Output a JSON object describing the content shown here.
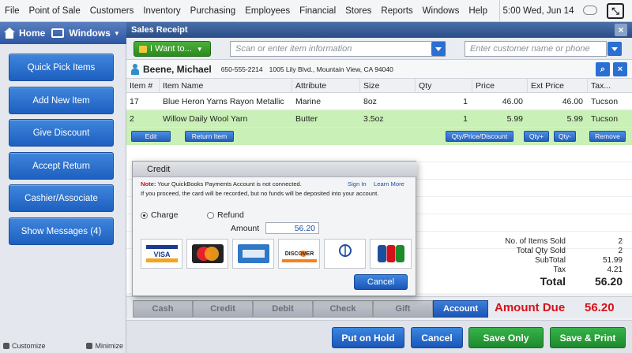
{
  "menubar": {
    "items": [
      "File",
      "Point of Sale",
      "Customers",
      "Inventory",
      "Purchasing",
      "Employees",
      "Financial",
      "Stores",
      "Reports",
      "Windows",
      "Help"
    ],
    "clock": "5:00 Wed, Jun 14"
  },
  "sidebar": {
    "home": "Home",
    "windows": "Windows",
    "buttons": [
      "Quick Pick Items",
      "Add New Item",
      "Give Discount",
      "Accept Return",
      "Cashier/Associate",
      "Show Messages (4)"
    ],
    "customize": "Customize",
    "minimize": "Minimize"
  },
  "window": {
    "title": "Sales Receipt",
    "close": "×"
  },
  "toolbar": {
    "iwant": "I Want to...",
    "scan_placeholder": "Scan or enter item information",
    "customer_placeholder": "Enter customer name or phone"
  },
  "customer": {
    "name": "Beene, Michael",
    "phone": "650-555-2214",
    "address": "1005 Lily Blvd., Mountain View, CA 94040"
  },
  "grid": {
    "headers": [
      "Item #",
      "Item Name",
      "Attribute",
      "Size",
      "Qty",
      "Price",
      "Ext Price",
      "Tax..."
    ],
    "rows": [
      {
        "item": "17",
        "name": "Blue Heron Yarns Rayon Metallic",
        "attribute": "Marine",
        "size": "8oz",
        "qty": "1",
        "price": "46.00",
        "ext": "46.00",
        "tax": "Tucson"
      },
      {
        "item": "2",
        "name": "Willow Daily Wool Yarn",
        "attribute": "Butter",
        "size": "3.5oz",
        "qty": "1",
        "price": "5.99",
        "ext": "5.99",
        "tax": "Tucson"
      }
    ],
    "actions": {
      "edit": "Edit",
      "return": "Return Item",
      "qtyprice": "Qty/Price/Discount",
      "qtyplus": "Qty+",
      "qtyminus": "Qty-",
      "remove": "Remove"
    }
  },
  "totals": {
    "items_sold_lbl": "No. of Items Sold",
    "items_sold": "2",
    "total_qty_lbl": "Total Qty Sold",
    "total_qty": "2",
    "subtotal_lbl": "SubTotal",
    "subtotal": "51.99",
    "tax_lbl": "Tax",
    "tax": "4.21",
    "total_lbl": "Total",
    "total": "56.20"
  },
  "payment": {
    "tabs": [
      "Cash",
      "Credit",
      "Debit",
      "Check",
      "Gift",
      "Account"
    ],
    "active": "Account",
    "amount_due_lbl": "Amount Due",
    "amount_due": "56.20"
  },
  "bottom": {
    "hold": "Put on Hold",
    "cancel": "Cancel",
    "save_only": "Save Only",
    "save_print": "Save & Print"
  },
  "credit_dialog": {
    "title": "Credit",
    "note_label": "Note:",
    "note": "Your QuickBooks Payments Account is not connected.",
    "sign_in": "Sign In",
    "learn_more": "Learn More",
    "warning": "If you proceed, the card will be recorded, but no funds will be deposited into your account.",
    "charge": "Charge",
    "refund": "Refund",
    "amount_lbl": "Amount",
    "amount": "56.20",
    "cards": [
      "VISA",
      "MasterCard",
      "American Express",
      "DISCOVER",
      "Diners Club International",
      "JCB"
    ],
    "cancel": "Cancel"
  },
  "colors": {
    "accent": "#2a6fd1",
    "selected_row": "#c9f0b6",
    "amount_due": "#d6101a",
    "save_green": "#1d8a2c"
  }
}
